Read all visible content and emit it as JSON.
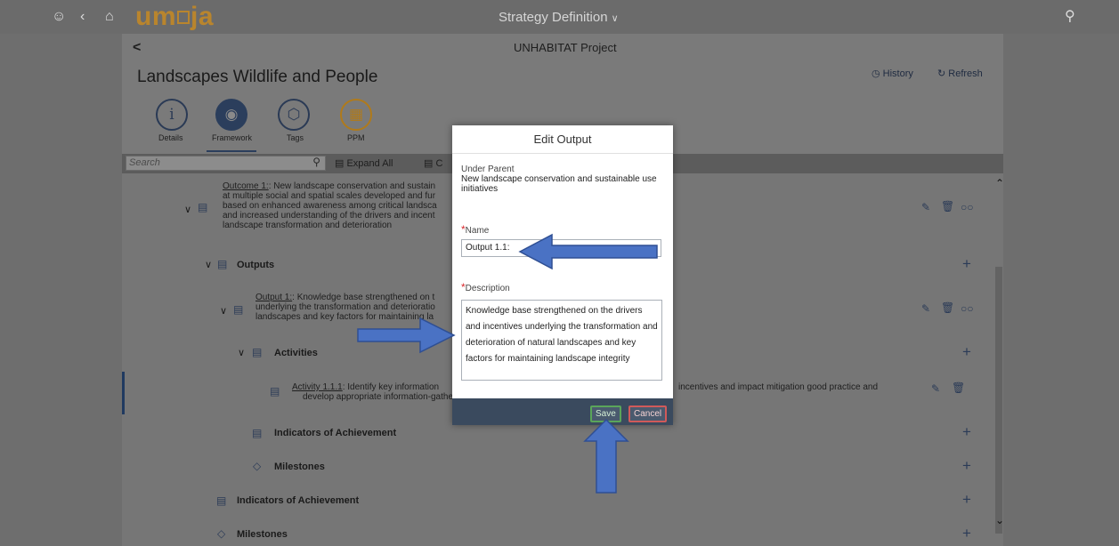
{
  "shell": {
    "app_name": "um□ja",
    "title": "Strategy Definition",
    "icons": [
      "user-icon",
      "back-icon",
      "home-icon",
      "search-icon"
    ]
  },
  "header": {
    "back": "<",
    "subtitle": "UNHABITAT Project",
    "title": "Landscapes Wildlife and People",
    "history": "History",
    "refresh": "Refresh"
  },
  "tabs": [
    {
      "label": "Details",
      "icon": "i"
    },
    {
      "label": "Framework",
      "icon": "◉"
    },
    {
      "label": "Tags",
      "icon": "⬡"
    },
    {
      "label": "PPM",
      "icon": "▦"
    }
  ],
  "toolbar": {
    "search_placeholder": "Search",
    "expand_all": "Expand All",
    "collapse_all": "C"
  },
  "tree": {
    "outcome_link": "Outcome 1:",
    "outcome_text_lines": [
      ": New landscape conservation and sustain",
      "at multiple social and spatial scales developed and fur",
      "based on enhanced awareness among critical landsca",
      "and increased understanding of the drivers and incent",
      "landscape transformation and deterioration"
    ],
    "outputs_label": "Outputs",
    "output_link": "Output 1:",
    "output_text_lines": [
      ": Knowledge base strengthened on t",
      "underlying the transformation and deterioratio",
      "landscapes and key factors for maintaining la"
    ],
    "activities_label": "Activities",
    "activity_link": "Activity 1.1.1",
    "activity_text_lines": [
      ": Identify key information",
      "develop appropriate information-gathe"
    ],
    "activity_text_right": "incentives and impact mitigation good practice and",
    "indicators_inner": "Indicators of Achievement",
    "milestones_inner": "Milestones",
    "indicators_outer": "Indicators of Achievement",
    "milestones_outer": "Milestones"
  },
  "modal": {
    "title": "Edit Output",
    "under_parent_label": "Under Parent",
    "under_parent_value": "New landscape conservation and sustainable use initiatives",
    "required_mark": "*",
    "name_label": "Name",
    "name_value": "Output 1.1:",
    "description_label": "Description",
    "description_value": "Knowledge base strengthened on the drivers and incentives underlying the transformation and deterioration of natural landscapes and key factors for maintaining landscape integrity",
    "save": "Save",
    "cancel": "Cancel"
  },
  "colors": {
    "accent": "#2b3e5c",
    "logo": "#b9852d",
    "required": "#d8282d",
    "annotation_arrow": "#4a72c4"
  }
}
